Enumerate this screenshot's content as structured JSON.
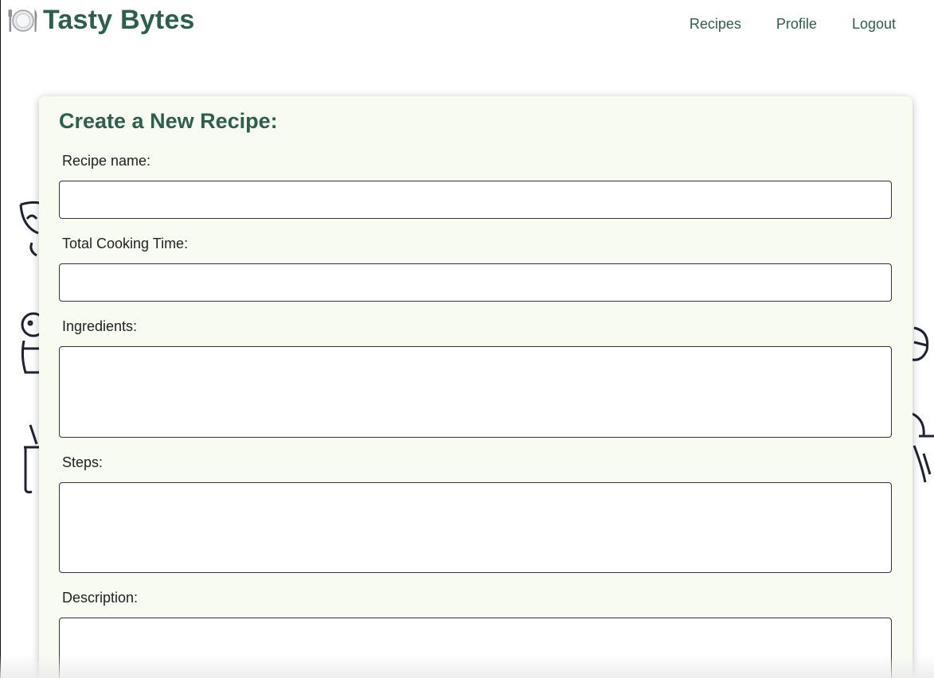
{
  "header": {
    "brand_icon": "plate-with-cutlery-icon",
    "brand_name": "Tasty Bytes",
    "nav": [
      {
        "label": "Recipes"
      },
      {
        "label": "Profile"
      },
      {
        "label": "Logout"
      }
    ]
  },
  "form": {
    "title": "Create a New Recipe:",
    "fields": [
      {
        "label": "Recipe name:",
        "value": "",
        "type": "text"
      },
      {
        "label": "Total Cooking Time:",
        "value": "",
        "type": "text"
      },
      {
        "label": "Ingredients:",
        "value": "",
        "type": "textarea"
      },
      {
        "label": "Steps:",
        "value": "",
        "type": "textarea"
      },
      {
        "label": "Description:",
        "value": "",
        "type": "textarea"
      }
    ]
  },
  "colors": {
    "brand": "#2e5e4e",
    "card_background": "#f8fcf0"
  }
}
